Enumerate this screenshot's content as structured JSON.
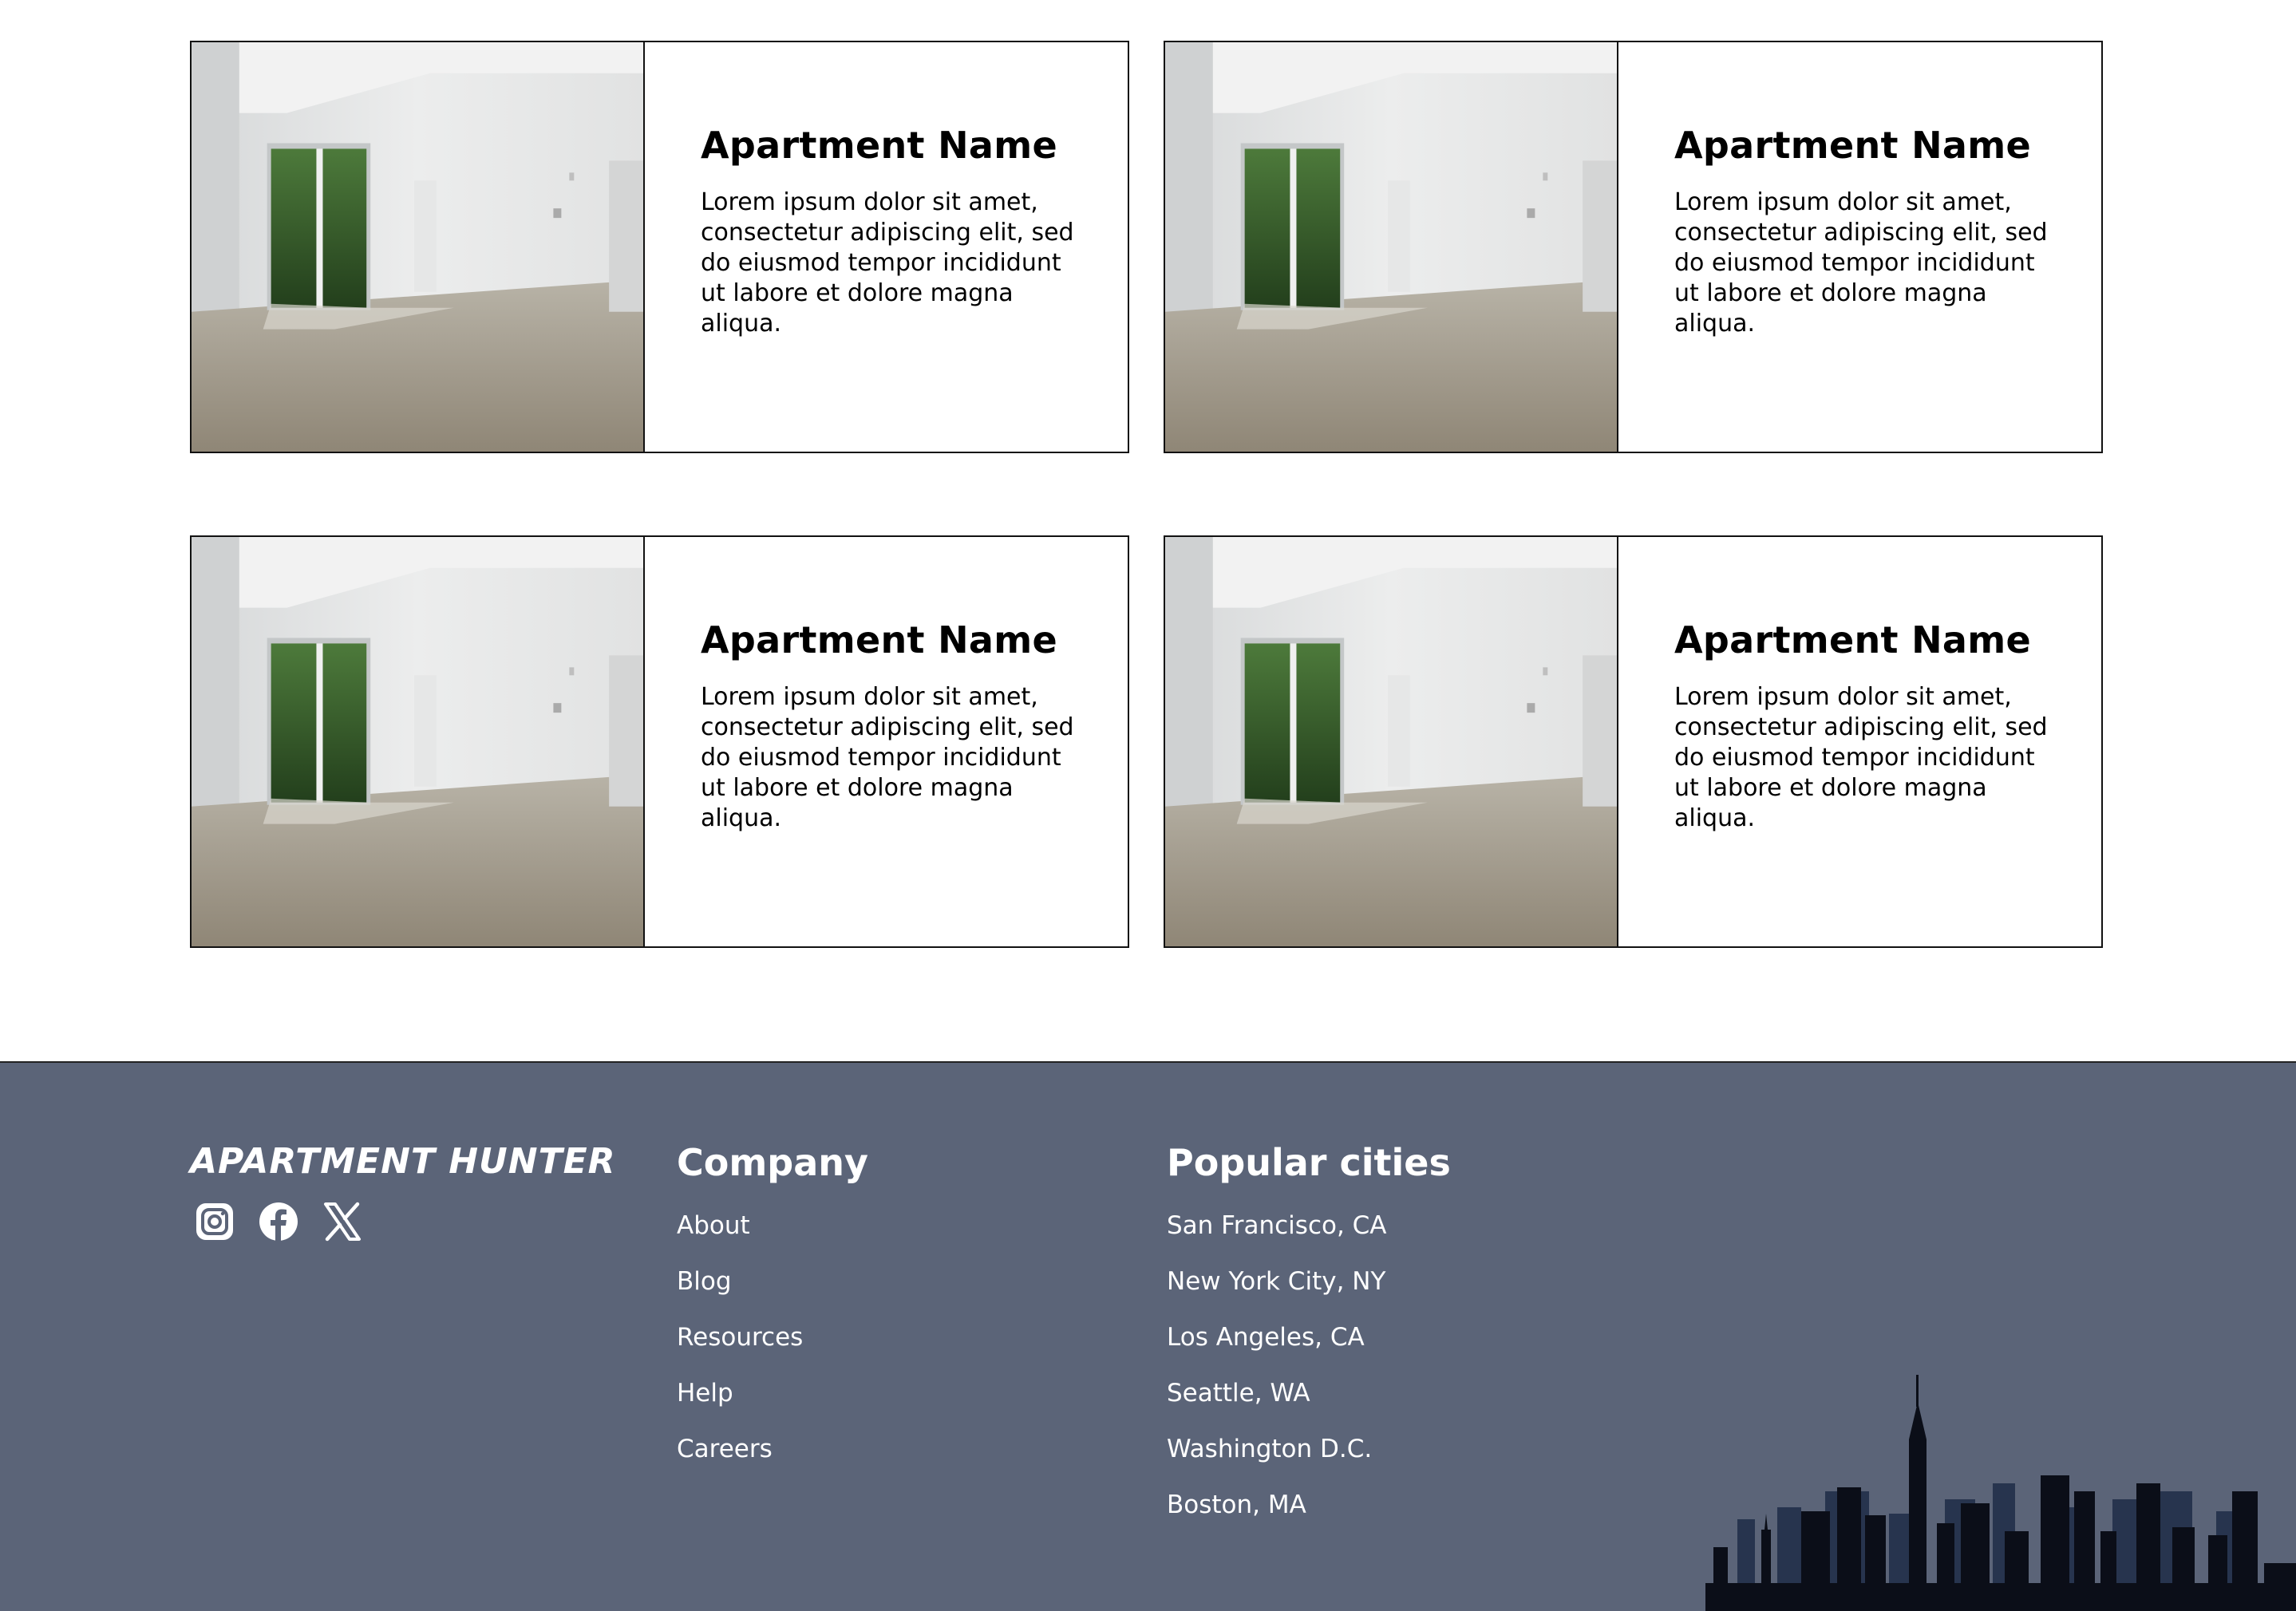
{
  "listings": [
    {
      "title": "Apartment Name",
      "description": "Lorem ipsum dolor sit amet, consectetur adipiscing elit, sed do eiusmod tempor incididunt ut labore et dolore magna aliqua."
    },
    {
      "title": "Apartment Name",
      "description": "Lorem ipsum dolor sit amet, consectetur adipiscing elit, sed do eiusmod tempor incididunt ut labore et dolore magna aliqua."
    },
    {
      "title": "Apartment Name",
      "description": "Lorem ipsum dolor sit amet, consectetur adipiscing elit, sed do eiusmod tempor incididunt ut labore et dolore magna aliqua."
    },
    {
      "title": "Apartment Name",
      "description": "Lorem ipsum dolor sit amet, consectetur adipiscing elit, sed do eiusmod tempor incididunt ut labore et dolore magna aliqua."
    }
  ],
  "footer": {
    "brand": "Apartment Hunter",
    "socials": [
      "instagram-icon",
      "facebook-icon",
      "x-icon"
    ],
    "company": {
      "heading": "Company",
      "links": [
        "About",
        "Blog",
        "Resources",
        "Help",
        "Careers"
      ]
    },
    "cities": {
      "heading": "Popular cities",
      "links": [
        "San Francisco, CA",
        "New York City, NY",
        "Los Angeles, CA",
        "Seattle, WA",
        "Washington D.C.",
        "Boston, MA"
      ]
    },
    "colors": {
      "background": "#5b6478",
      "text": "#ffffff",
      "skyline_dark": "#0b0e18",
      "skyline_mid": "#27344e"
    }
  }
}
